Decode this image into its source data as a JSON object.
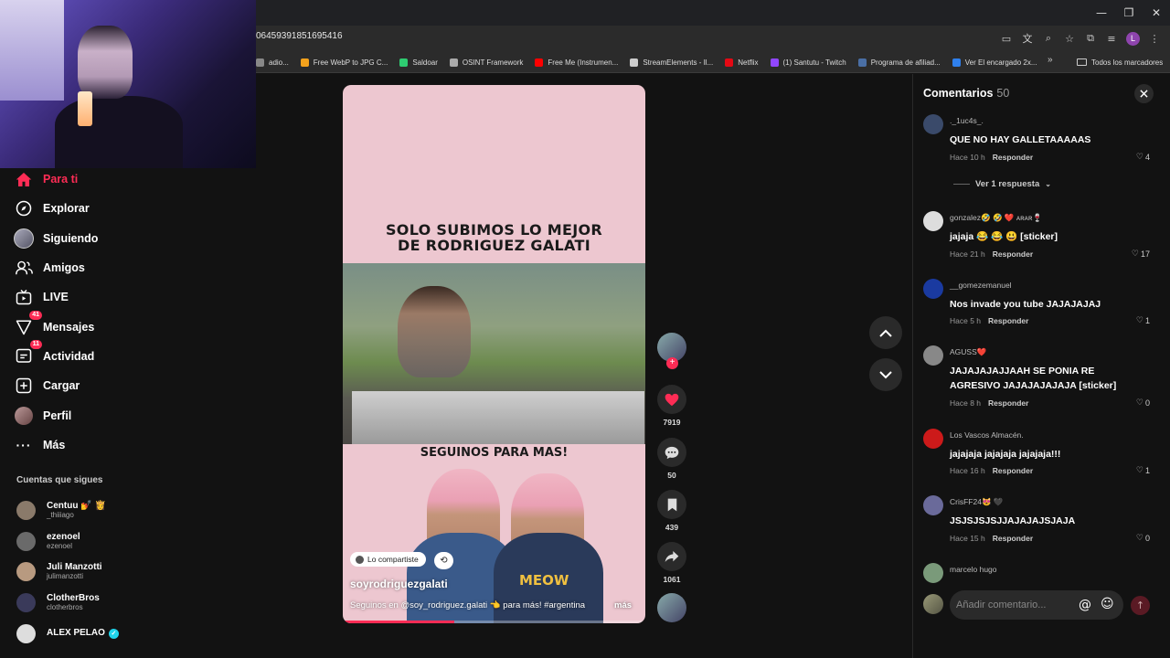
{
  "browser": {
    "url_fragment": "06459391851695416",
    "window_controls": [
      "—",
      "❐",
      "✕"
    ],
    "bookmarks": [
      {
        "label": "adio...",
        "icon": "page-icon",
        "color": "#888888"
      },
      {
        "label": "Free WebP to JPG C...",
        "icon": "webp-icon",
        "color": "#f4a21c"
      },
      {
        "label": "Saldoar",
        "icon": "saldoar-icon",
        "color": "#2ecc71"
      },
      {
        "label": "OSINT Framework",
        "icon": "globe-icon",
        "color": "#aaaaaa"
      },
      {
        "label": "Free Me (Instrumen...",
        "icon": "youtube-icon",
        "color": "#ff0000"
      },
      {
        "label": "StreamElements - Il...",
        "icon": "streamelements-icon",
        "color": "#cccccc"
      },
      {
        "label": "Netflix",
        "icon": "netflix-icon",
        "color": "#e50914"
      },
      {
        "label": "(1) Santutu - Twitch",
        "icon": "twitch-icon",
        "color": "#9146ff"
      },
      {
        "label": "Programa de afiliad...",
        "icon": "affiliate-icon",
        "color": "#4a6fa5"
      },
      {
        "label": "Ver El encargado 2x...",
        "icon": "play-icon",
        "color": "#2f80ed"
      }
    ],
    "bookmarks_more": "»",
    "all_bookmarks": "Todos los marcadores",
    "profile_initial": "L"
  },
  "sidebar": {
    "items": [
      {
        "label": "Para ti",
        "icon": "home-icon",
        "active": true
      },
      {
        "label": "Explorar",
        "icon": "compass-icon"
      },
      {
        "label": "Siguiendo",
        "icon": "following-avatar-icon"
      },
      {
        "label": "Amigos",
        "icon": "friends-icon"
      },
      {
        "label": "LIVE",
        "icon": "live-icon"
      },
      {
        "label": "Mensajes",
        "icon": "messages-icon",
        "badge": "41"
      },
      {
        "label": "Actividad",
        "icon": "activity-icon",
        "badge": "11"
      },
      {
        "label": "Cargar",
        "icon": "upload-icon"
      },
      {
        "label": "Perfil",
        "icon": "profile-avatar-icon"
      },
      {
        "label": "Más",
        "icon": "more-icon"
      }
    ],
    "following_title": "Cuentas que sigues",
    "following": [
      {
        "name": "Centuu 💅 👸",
        "user": "_thiiiago"
      },
      {
        "name": "ezenoel",
        "user": "ezenoel"
      },
      {
        "name": "Juli Manzotti",
        "user": "julimanzotti"
      },
      {
        "name": "ClotherBros",
        "user": "clotherbros"
      },
      {
        "name": "ALEX PELAO",
        "user": ""
      }
    ]
  },
  "video": {
    "overlay_title_line1": "SOLO SUBIMOS LO MEJOR",
    "overlay_title_line2": "DE RODRIGUEZ GALATI",
    "overlay_subtitle": "SEGUINOS PARA MAS!",
    "shirt_text": "MEOW",
    "shared_label": "Lo compartiste",
    "author": "soyrodriguezgalati",
    "caption": "Seguinos en @soy_rodriguez.galati 👈 para más! #argentina",
    "more": "más",
    "progress": 0.37
  },
  "actions": {
    "likes": "7919",
    "comments": "50",
    "saves": "439",
    "shares": "1061"
  },
  "comments": {
    "title": "Comentarios",
    "count": "50",
    "items": [
      {
        "user": "._1uc4s_.",
        "text": "QUE NO HAY GALLETAAAAAS",
        "time": "Hace 10 h",
        "reply": "Responder",
        "likes": "4",
        "avatar": "#3a4a6a"
      },
      {
        "user": "gonzalez🤣 🤣 ❤️ ᴀʀᴀʀ🍷",
        "text": "jajaja 😂 😂 😃 [sticker]",
        "time": "Hace 21 h",
        "reply": "Responder",
        "likes": "17",
        "avatar": "#dddddd"
      },
      {
        "user": "__gomezemanuel",
        "text": "Nos invade you tube JAJAJAJAJ",
        "time": "Hace 5 h",
        "reply": "Responder",
        "likes": "1",
        "avatar": "#1a3aa0"
      },
      {
        "user": "AGUSS❤️",
        "text": "JAJAJAJAJJAAH SE PONIA RE AGRESIVO JAJAJAJAJAJA [sticker]",
        "time": "Hace 8 h",
        "reply": "Responder",
        "likes": "0",
        "avatar": "#888888"
      },
      {
        "user": "Los Vascos Almacén.",
        "text": "jajajaja jajajaja jajajaja!!!",
        "time": "Hace 16 h",
        "reply": "Responder",
        "likes": "1",
        "avatar": "#cc1a1a"
      },
      {
        "user": "CrisFF24😻 🖤",
        "text": "JSJSJSJSJJAJAJAJSJAJA",
        "time": "Hace 15 h",
        "reply": "Responder",
        "likes": "0",
        "avatar": "#6a6a9a"
      },
      {
        "user": "marcelo hugo",
        "text": "",
        "time": "",
        "reply": "",
        "likes": "",
        "avatar": "#7a9a7a"
      }
    ],
    "view_replies": "Ver 1 respuesta",
    "input_placeholder": "Añadir comentario...",
    "at_symbol": "@"
  }
}
